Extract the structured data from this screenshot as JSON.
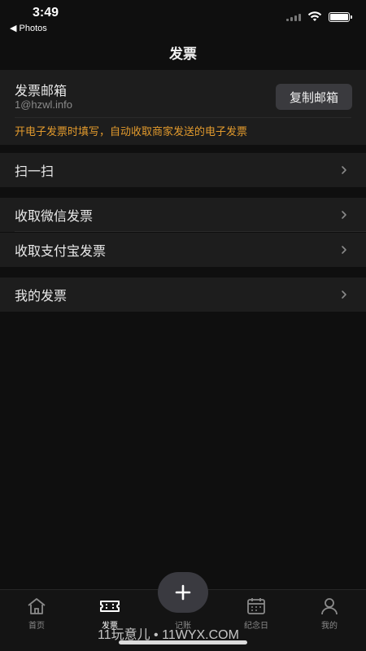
{
  "status_bar": {
    "time": "3:49",
    "back_label": "◀ Photos"
  },
  "nav": {
    "title": "发票"
  },
  "email_card": {
    "label": "发票邮箱",
    "value": "1@hzwl.info",
    "copy_button": "复制邮箱",
    "hint": "开电子发票时填写，自动收取商家发送的电子发票",
    "hint_color": "#e29a2d"
  },
  "menu": {
    "scan": "扫一扫",
    "wechat_invoice": "收取微信发票",
    "alipay_invoice": "收取支付宝发票",
    "my_invoices": "我的发票"
  },
  "tab_bar": {
    "tabs": [
      {
        "label": "首页",
        "icon": "home-icon"
      },
      {
        "label": "发票",
        "icon": "ticket-icon",
        "active": true
      },
      {
        "label": "记账",
        "icon": "plus-icon"
      },
      {
        "label": "纪念日",
        "icon": "calendar-icon"
      },
      {
        "label": "我的",
        "icon": "user-icon"
      }
    ]
  },
  "watermark": "11玩意儿 • 11WYX.COM"
}
